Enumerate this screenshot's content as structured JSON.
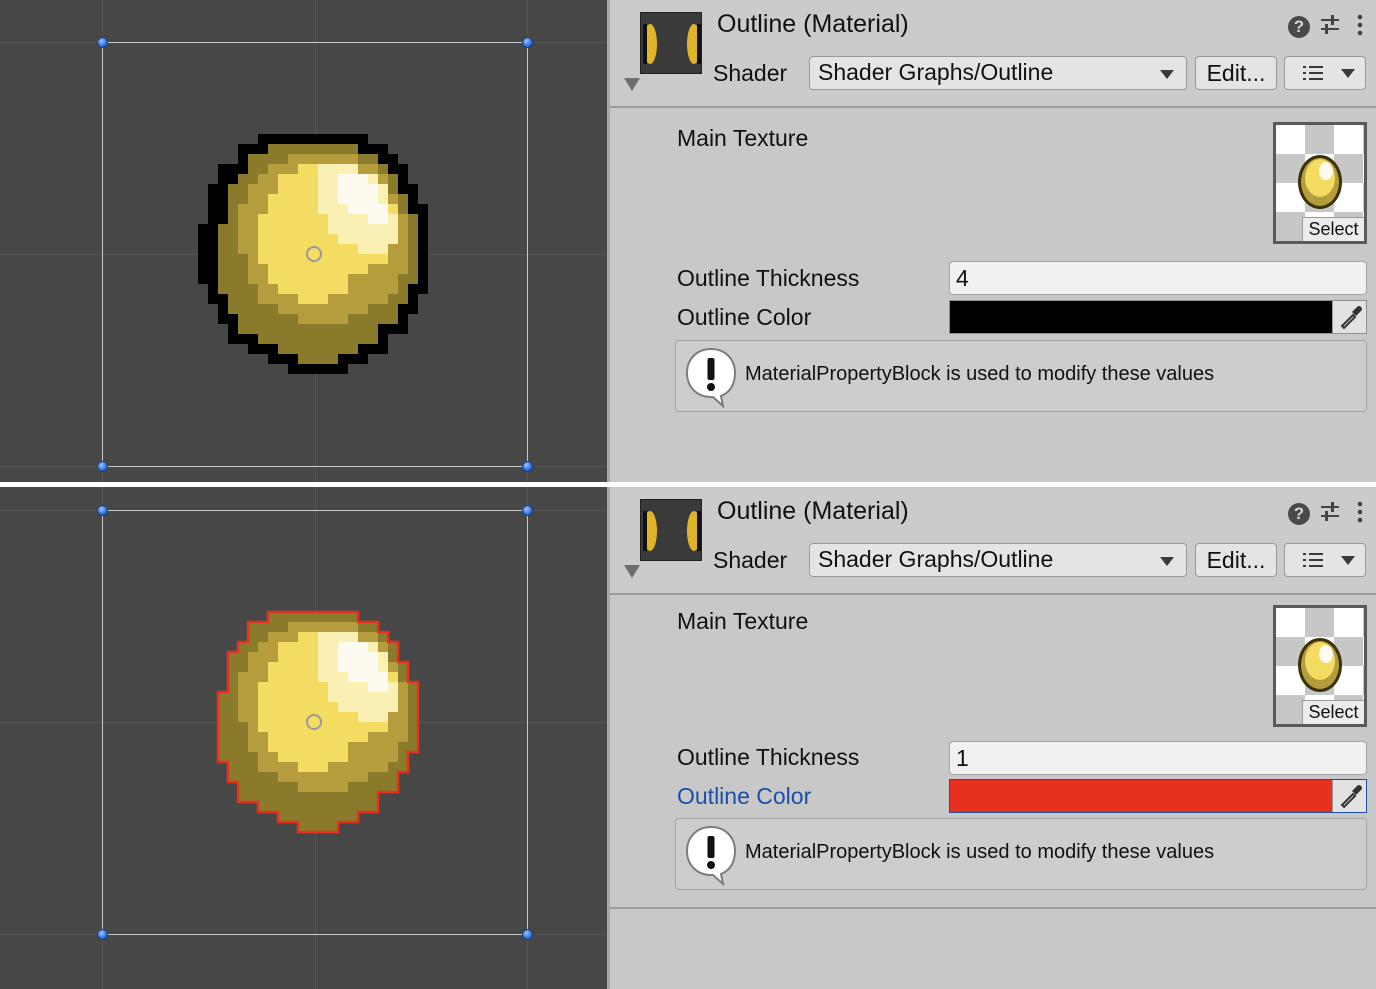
{
  "panels": [
    {
      "inspector": {
        "title": "Outline (Material)",
        "shader_label": "Shader",
        "shader_value": "Shader Graphs/Outline",
        "edit_label": "Edit...",
        "main_texture_label": "Main Texture",
        "texture_select_label": "Select",
        "thickness_label": "Outline Thickness",
        "thickness_value": "4",
        "color_label": "Outline Color",
        "color_value": "#000000",
        "helpbox_text": "MaterialPropertyBlock is used to modify these values"
      },
      "scene": {
        "outline_color": "#000000",
        "outline_thickness": 4
      }
    },
    {
      "inspector": {
        "title": "Outline (Material)",
        "shader_label": "Shader",
        "shader_value": "Shader Graphs/Outline",
        "edit_label": "Edit...",
        "main_texture_label": "Main Texture",
        "texture_select_label": "Select",
        "thickness_label": "Outline Thickness",
        "thickness_value": "1",
        "color_label": "Outline Color",
        "color_value": "#e8301e",
        "helpbox_text": "MaterialPropertyBlock is used to modify these values"
      },
      "scene": {
        "outline_color": "#e8301e",
        "outline_thickness": 1
      }
    }
  ],
  "icons": [
    "help-icon",
    "preset-sliders-icon",
    "kebab-menu-icon",
    "list-menu-icon",
    "eyedropper-icon",
    "warning-bubble-icon",
    "foldout-arrow-icon"
  ]
}
